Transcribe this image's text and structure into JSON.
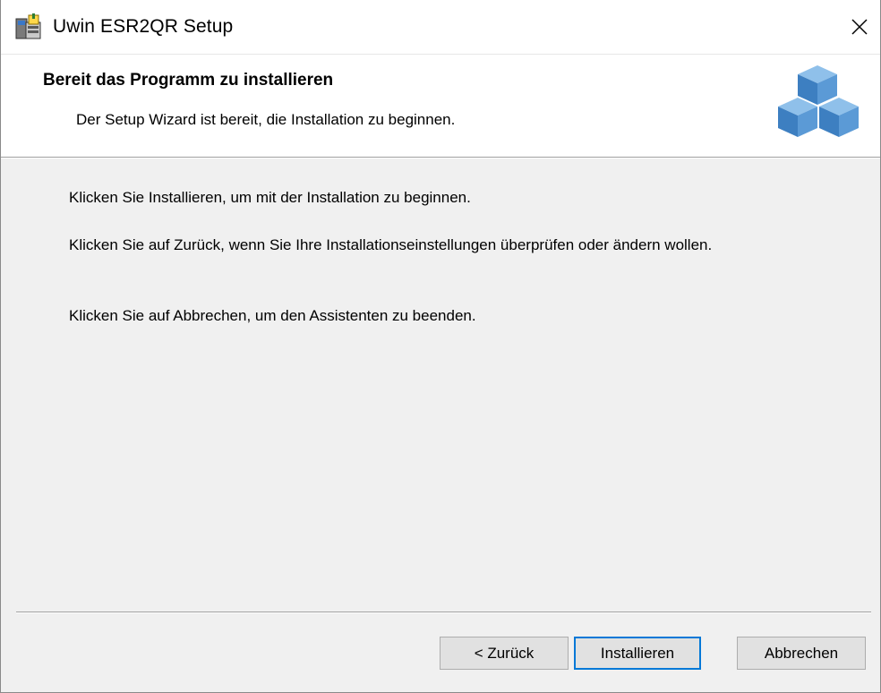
{
  "window": {
    "title": "Uwin ESR2QR Setup",
    "close_icon": "close-icon"
  },
  "banner": {
    "title": "Bereit das Programm zu installieren",
    "subtitle": "Der Setup Wizard ist bereit, die Installation zu beginnen.",
    "graphic_icon": "blue-cubes-icon"
  },
  "content": {
    "paragraphs": [
      "Klicken Sie Installieren, um mit der Installation zu beginnen.",
      "Klicken Sie auf Zurück, wenn Sie Ihre Installationseinstellungen überprüfen oder ändern wollen.",
      "Klicken Sie auf Abbrechen, um den Assistenten zu beenden."
    ]
  },
  "buttons": {
    "back": "< Zurück",
    "install": "Installieren",
    "cancel": "Abbrechen"
  },
  "colors": {
    "accent": "#0078d7",
    "cube": "#4a8fce"
  }
}
